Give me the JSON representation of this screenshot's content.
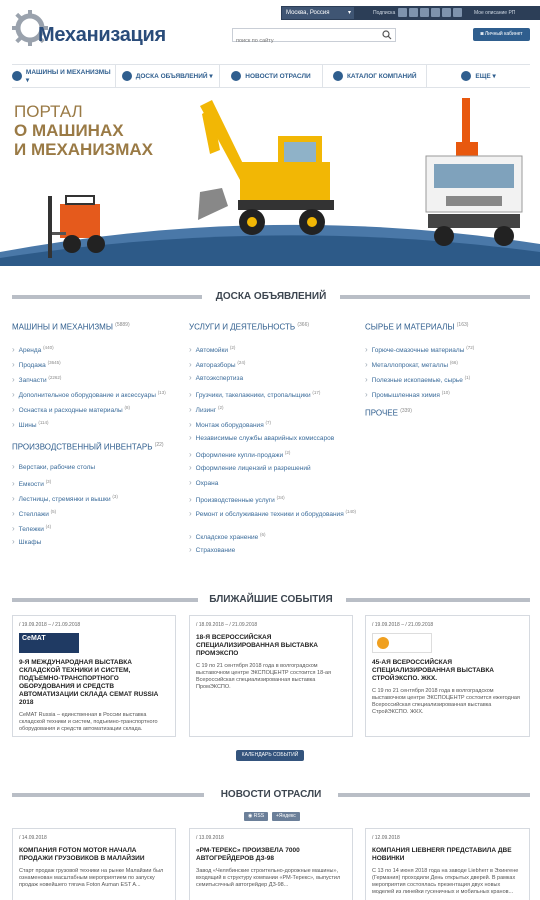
{
  "header": {
    "city": "Москва, Россия",
    "subscribe_label": "Подписка",
    "lang_label": "Мое описание РП",
    "logo": "Механизация",
    "search_placeholder": "поиск по сайту",
    "cabinet": "Личный кабинет"
  },
  "nav": [
    {
      "label": "Машины и механизмы ▾",
      "icon": "machine-icon"
    },
    {
      "label": "Доска объявлений ▾",
      "icon": "board-icon"
    },
    {
      "label": "Новости отрасли",
      "icon": "news-icon"
    },
    {
      "label": "Каталог компаний",
      "icon": "catalog-icon"
    },
    {
      "label": "Еще ▾",
      "icon": "more-icon"
    }
  ],
  "hero": {
    "line1": "ПОРТАЛ",
    "line2": "О МАШИНАХ",
    "line3": "И МЕХАНИЗМАХ"
  },
  "board": {
    "title": "ДОСКА ОБЪЯВЛЕНИЙ",
    "col1": {
      "title": "МАШИНЫ И МЕХАНИЗМЫ",
      "count": "(5889)",
      "items": [
        {
          "label": "Аренда",
          "count": "(440)"
        },
        {
          "label": "Продажа",
          "count": "(3645)"
        },
        {
          "label": "Запчасти",
          "count": "(2262)"
        },
        {
          "label": "Дополнительное оборудование и аксессуары",
          "count": "(13)"
        },
        {
          "label": "Оснастка и расходные материалы",
          "count": "(8)"
        },
        {
          "label": "Шины",
          "count": "(114)"
        }
      ],
      "title2": "ПРОИЗВОДСТВЕННЫЙ ИНВЕНТАРЬ",
      "count2": "(22)",
      "items2": [
        {
          "label": "Верстаки, рабочие столы",
          "count": ""
        },
        {
          "label": "Емкости",
          "count": "(3)"
        },
        {
          "label": "Лестницы, стремянки и вышки",
          "count": "(3)"
        },
        {
          "label": "Стеллажи",
          "count": "(5)"
        },
        {
          "label": "Тележки",
          "count": "(4)"
        },
        {
          "label": "Шкафы",
          "count": ""
        }
      ]
    },
    "col2": {
      "title": "УСЛУГИ И ДЕЯТЕЛЬНОСТЬ",
      "count": "(366)",
      "items": [
        {
          "label": "Автомойки",
          "count": "(2)"
        },
        {
          "label": "Авторазборы",
          "count": "(24)"
        },
        {
          "label": "Автоэкспертиза",
          "count": ""
        },
        {
          "label": "Грузчики, такелажники, стропальщики",
          "count": "(17)"
        },
        {
          "label": "Лизинг",
          "count": "(2)"
        },
        {
          "label": "Монтаж оборудования",
          "count": "(7)"
        },
        {
          "label": "Независимые службы аварийных комиссаров",
          "count": ""
        },
        {
          "label": "Оформление купли-продажи",
          "count": "(2)"
        },
        {
          "label": "Оформление лицензий и разрешений",
          "count": ""
        },
        {
          "label": "Охрана",
          "count": ""
        },
        {
          "label": "Производственные услуги",
          "count": "(34)"
        },
        {
          "label": "Ремонт и обслуживание техники и оборудования",
          "count": "(140)"
        },
        {
          "label": "Складское хранение",
          "count": "(6)"
        },
        {
          "label": "Страхование",
          "count": ""
        }
      ]
    },
    "col3": {
      "title": "СЫРЬЕ И МАТЕРИАЛЫ",
      "count": "(163)",
      "items": [
        {
          "label": "Горюче-смазочные материалы",
          "count": "(72)"
        },
        {
          "label": "Металлопрокат, металлы",
          "count": "(66)"
        },
        {
          "label": "Полезные ископаемые, сырье",
          "count": "(1)"
        },
        {
          "label": "Промышленная химия",
          "count": "(10)"
        }
      ],
      "title2": "ПРОЧЕЕ",
      "count2": "(339)"
    }
  },
  "events": {
    "title": "БЛИЖАЙШИЕ СОБЫТИЯ",
    "calendar": "КАЛЕНДАРЬ СОБЫТИЙ",
    "cards": [
      {
        "date": "/ 19.09.2018 – / 21.09.2018",
        "logo": "CeMAT",
        "title": "9-Я МЕЖДУНАРОДНАЯ ВЫСТАВКА СКЛАДСКОЙ ТЕХНИКИ И СИСТЕМ, ПОДЪЕМНО-ТРАНСПОРТНОГО ОБОРУДОВАНИЯ И СРЕДСТВ АВТОМАТИЗАЦИИ СКЛАДА CEMAT RUSSIA 2018",
        "text": "CeMAT Russia – единственная в России выставка складской техники и систем, подъемно-транспортного оборудования и средств автоматизации склада."
      },
      {
        "date": "/ 18.09.2018 – / 21.09.2018",
        "logo": "",
        "title": "18-Я ВСЕРОССИЙСКАЯ СПЕЦИАЛИЗИРОВАННАЯ ВЫСТАВКА ПРОМЭКСПО",
        "text": "С 19 по 21 сентября 2018 года в волгоградском выставочном центре ЭКСПОЦЕНТР состоится 18-ая Всероссийская специализированная выставка ПромЭКСПО."
      },
      {
        "date": "/ 19.09.2018 – / 21.09.2018",
        "logo": "",
        "title": "45-АЯ ВСЕРОССИЙСКАЯ СПЕЦИАЛИЗИРОВАННАЯ ВЫСТАВКА СТРОЙЭКСПО. ЖКХ.",
        "text": "С 19 по 21 сентября 2018 года в волгоградском выставочном центре ЭКСПОЦЕНТР состоится ежегодная Всероссийская специализированная выставка СтройЭКСПО. ЖКХ."
      }
    ]
  },
  "news": {
    "title": "НОВОСТИ ОТРАСЛИ",
    "rss": "RSS",
    "yandex": "Яндекс",
    "cards": [
      {
        "date": "/ 14.09.2018",
        "title": "КОМПАНИЯ FOTON MOTOR НАЧАЛА ПРОДАЖИ ГРУЗОВИКОВ В МАЛАЙЗИИ",
        "text": "Старт продаж грузовой техники на рынке Малайзии был ознаменован масштабным мероприятием по запуску продаж новейшего тягача Foton Auman EST A..."
      },
      {
        "date": "/ 13.09.2018",
        "title": "«РМ-ТЕРЕКС» ПРОИЗВЕЛА 7000 АВТОГРЕЙДЕРОВ ДЗ-98",
        "text": "Завод «Челябинские строительно-дорожные машины», входящий в структуру компании «РМ-Терекс», выпустил семитысячный автогрейдер ДЗ-98..."
      },
      {
        "date": "/ 12.09.2018",
        "title": "КОМПАНИЯ LIEBHERR ПРЕДСТАВИЛА ДВЕ НОВИНКИ",
        "text": "С 13 по 14 июня 2018 года на заводе Liebherr в Эхингене (Германия) проходили День открытых дверей. В рамках мероприятия состоялась презентация двух новых моделей из линейки гусеничных и мобильных кранов..."
      }
    ]
  },
  "colors": {
    "brand": "#2f5e8e",
    "topbar": "#2c3e57",
    "hero_text": "#9a7a45"
  }
}
